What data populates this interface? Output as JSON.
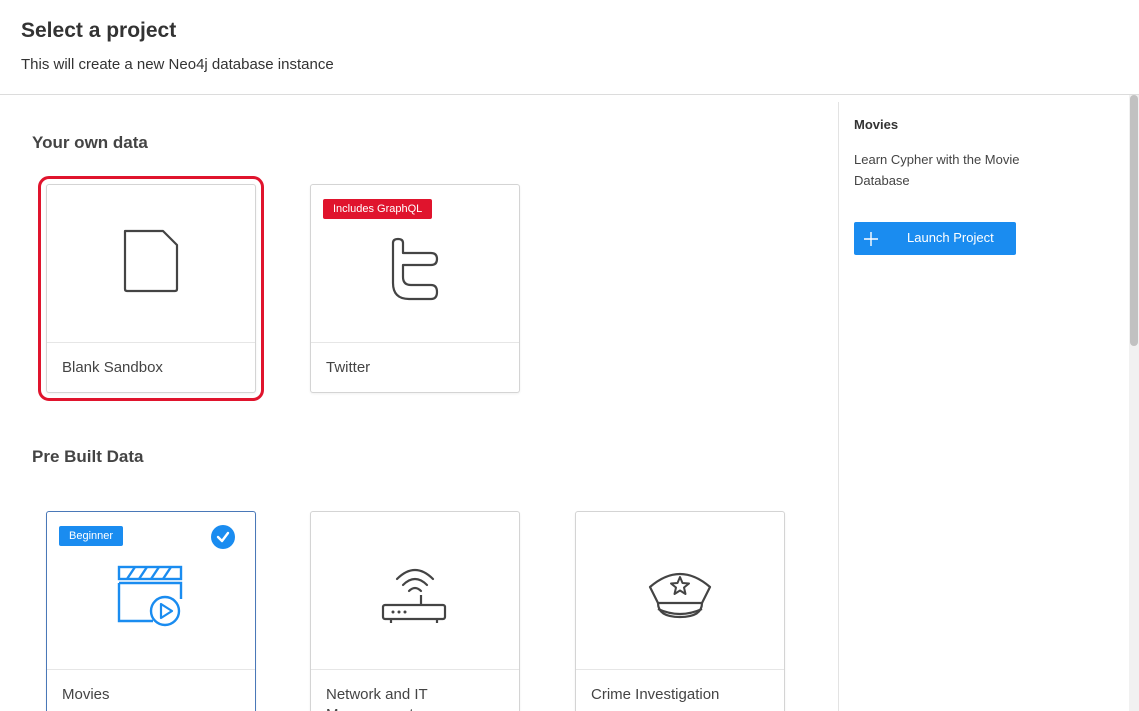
{
  "header": {
    "title": "Select a project",
    "subtitle": "This will create a new Neo4j database instance"
  },
  "sections": {
    "own_data": {
      "title": "Your own data",
      "cards": [
        {
          "label": "Blank Sandbox",
          "icon": "file-icon"
        },
        {
          "label": "Twitter",
          "icon": "twitter-icon",
          "badge": "Includes GraphQL"
        }
      ]
    },
    "prebuilt": {
      "title": "Pre Built Data",
      "cards": [
        {
          "label": "Movies",
          "icon": "movie-icon",
          "badge": "Beginner",
          "checked": true
        },
        {
          "label": "Network and IT Management",
          "icon": "router-icon"
        },
        {
          "label": "Crime Investigation",
          "icon": "police-hat-icon"
        }
      ]
    }
  },
  "side_panel": {
    "title": "Movies",
    "description": "Learn Cypher with the Movie Database",
    "launch_label": "Launch Project"
  },
  "colors": {
    "accent": "#1a8cf0",
    "highlight": "#e0142d",
    "badge_red": "#e0142d"
  }
}
